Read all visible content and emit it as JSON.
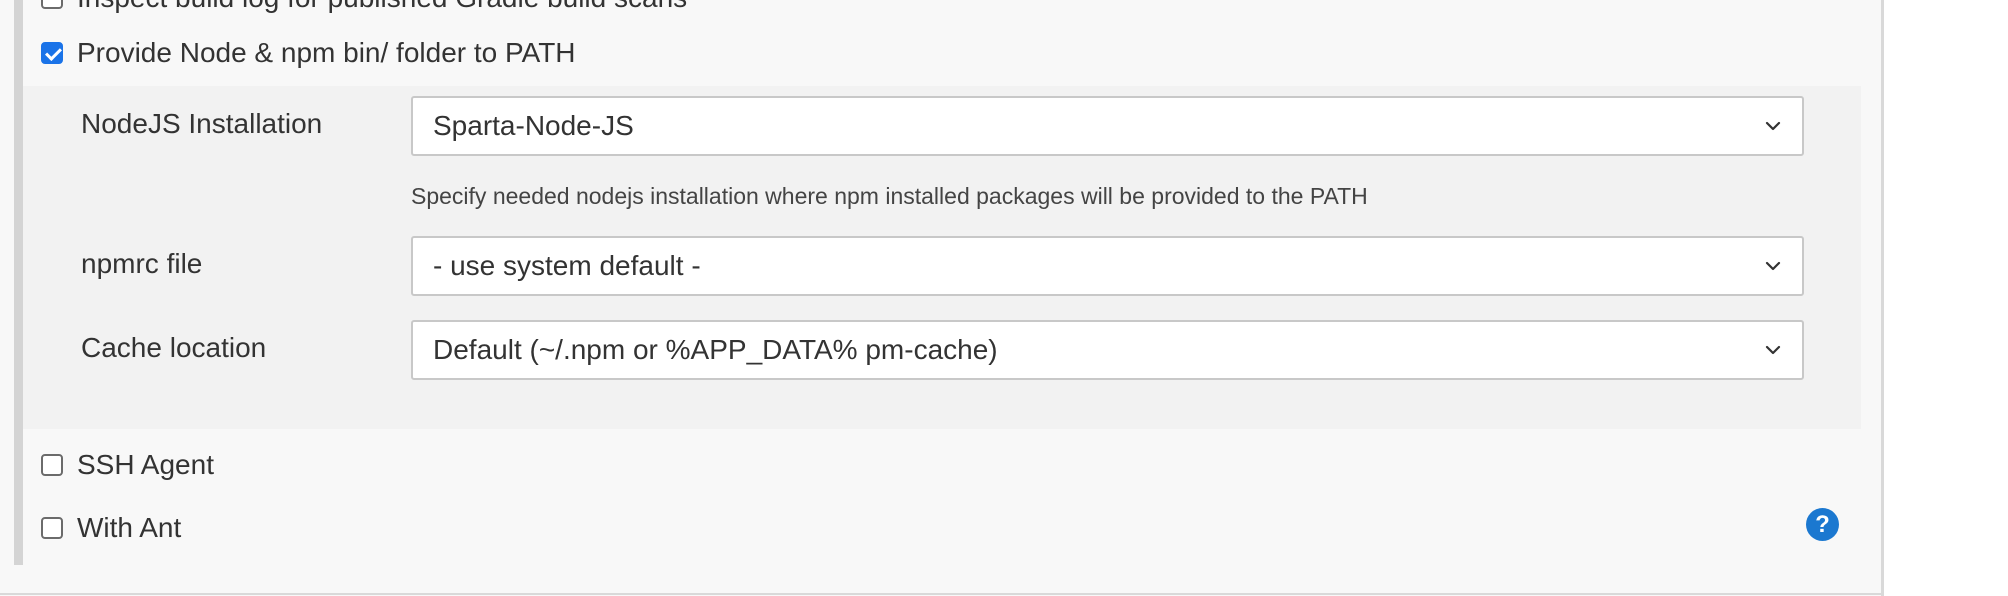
{
  "build_env": {
    "inspect_log_label": "Inspect build log for published Gradle build scans",
    "nodejs": {
      "checkbox_label": "Provide Node & npm bin/ folder to PATH",
      "checked": true,
      "installation": {
        "label": "NodeJS Installation",
        "value": "Sparta-Node-JS",
        "help": "Specify needed nodejs installation where npm installed packages will be provided to the PATH"
      },
      "npmrc": {
        "label": "npmrc file",
        "value": "- use system default -"
      },
      "cache": {
        "label": "Cache location",
        "value": "Default (~/.npm or %APP_DATA% pm-cache)"
      }
    },
    "ssh_agent": {
      "label": "SSH Agent",
      "checked": false
    },
    "with_ant": {
      "label": "With Ant",
      "checked": false
    },
    "help_icon": "question-circle-icon",
    "accent_color": "#1b78d0"
  }
}
